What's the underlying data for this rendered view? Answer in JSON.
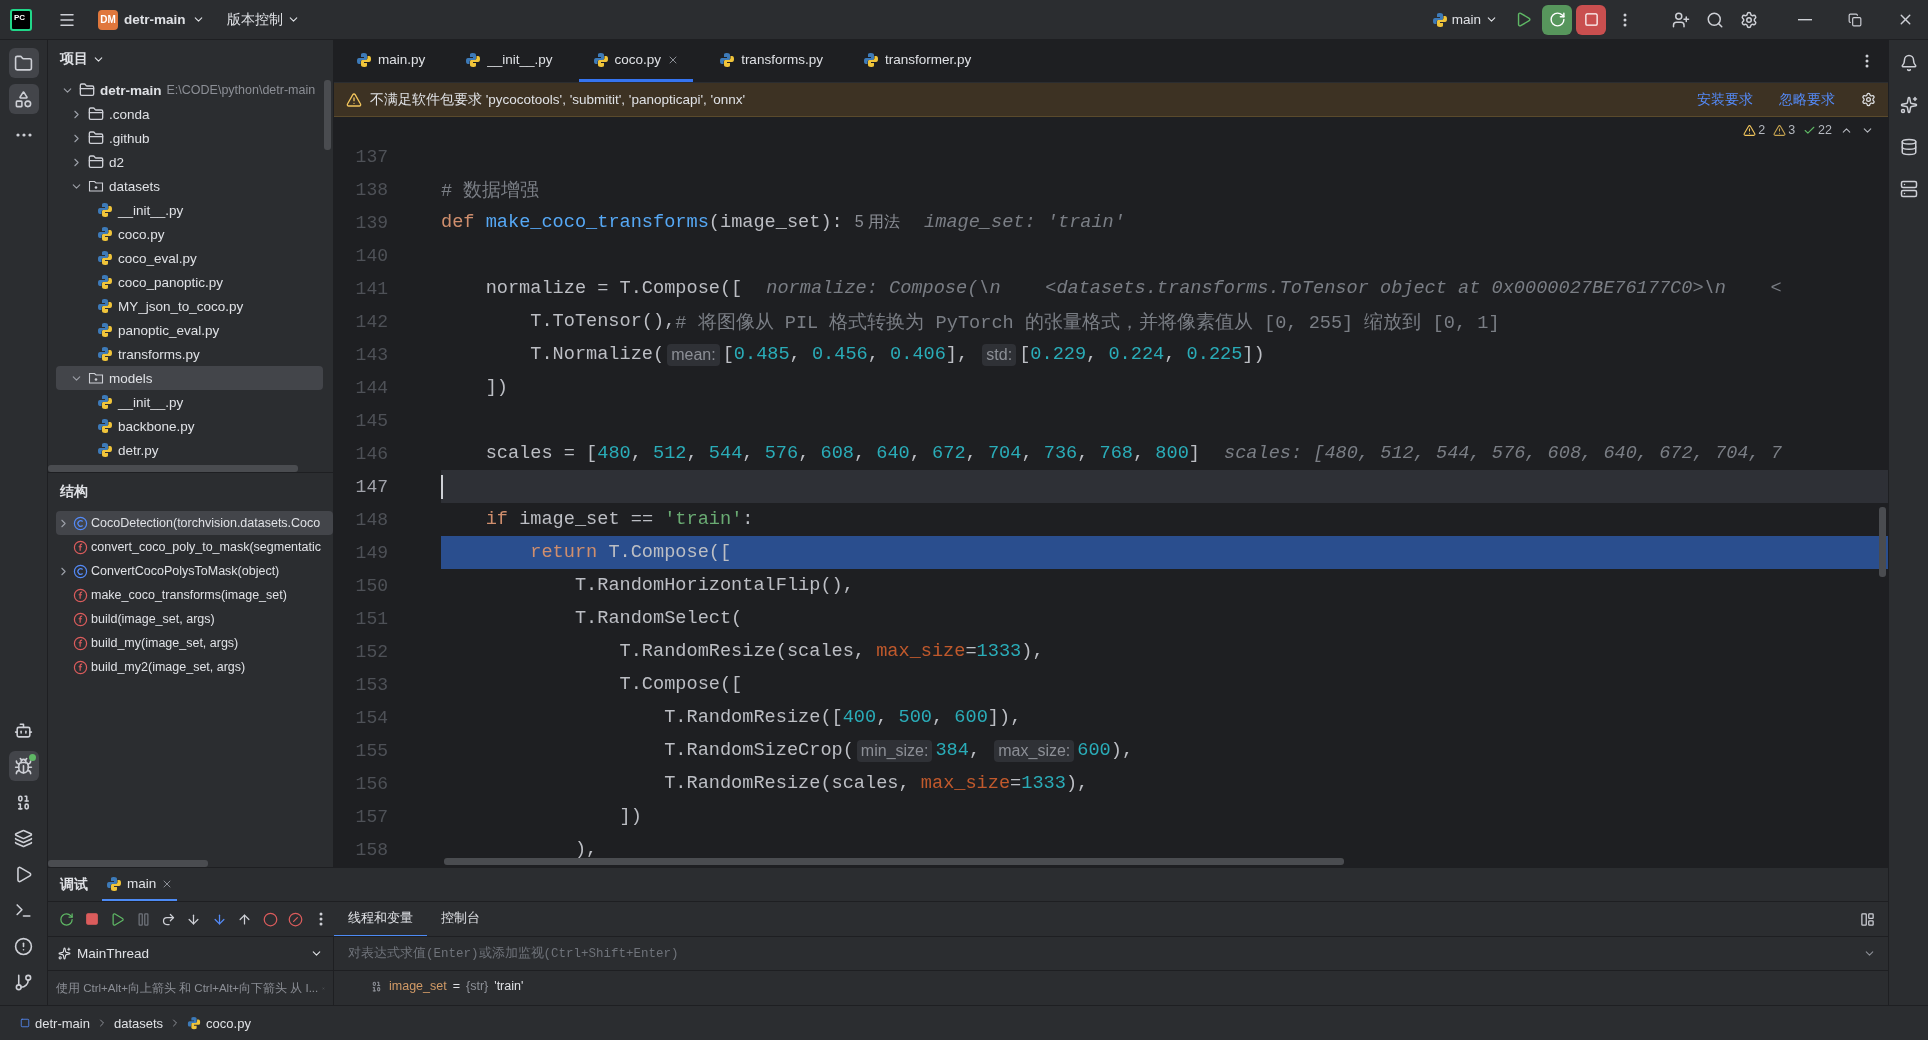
{
  "title_bar": {
    "logo": "PC",
    "project_badge": "DM",
    "project": "detr-main",
    "vcs": "版本控制",
    "run_config": "main"
  },
  "left_toolbar": {
    "top": [
      {
        "kind": "project",
        "selected": true
      },
      {
        "kind": "structure",
        "selected": true
      },
      {
        "kind": "more",
        "selected": false
      }
    ],
    "bottom": [
      {
        "kind": "bot",
        "selected": false
      },
      {
        "kind": "debug",
        "selected": true
      },
      {
        "kind": "python",
        "selected": false
      },
      {
        "kind": "layers",
        "selected": false
      },
      {
        "kind": "run",
        "selected": false
      },
      {
        "kind": "terminal",
        "selected": false
      },
      {
        "kind": "problems",
        "selected": false
      },
      {
        "kind": "git",
        "selected": false
      }
    ]
  },
  "project_panel": {
    "title": "项目",
    "tree": [
      {
        "kind": "folder",
        "label": "detr-main",
        "path": "E:\\CODE\\python\\detr-main",
        "expanded": true,
        "selected": false,
        "children": [
          {
            "kind": "folder",
            "label": ".conda",
            "expanded": false,
            "selected": false
          },
          {
            "kind": "folder",
            "label": ".github",
            "expanded": false,
            "selected": false
          },
          {
            "kind": "folder",
            "label": "d2",
            "expanded": false,
            "selected": false
          },
          {
            "kind": "package",
            "label": "datasets",
            "expanded": true,
            "selected": false,
            "children": [
              {
                "kind": "python",
                "label": "__init__.py",
                "selected": false
              },
              {
                "kind": "python",
                "label": "coco.py",
                "selected": false
              },
              {
                "kind": "python",
                "label": "coco_eval.py",
                "selected": false
              },
              {
                "kind": "python",
                "label": "coco_panoptic.py",
                "selected": false
              },
              {
                "kind": "python",
                "label": "MY_json_to_coco.py",
                "selected": false
              },
              {
                "kind": "python",
                "label": "panoptic_eval.py",
                "selected": false
              },
              {
                "kind": "python",
                "label": "transforms.py",
                "selected": false
              }
            ]
          },
          {
            "kind": "package",
            "label": "models",
            "expanded": true,
            "selected": true,
            "children": [
              {
                "kind": "python",
                "label": "__init__.py",
                "selected": false
              },
              {
                "kind": "python",
                "label": "backbone.py",
                "selected": false
              },
              {
                "kind": "python",
                "label": "detr.py",
                "selected": false
              }
            ]
          }
        ]
      }
    ]
  },
  "structure_panel": {
    "title": "结构",
    "items": [
      {
        "kind": "class",
        "label": "CocoDetection(torchvision.datasets.Coco",
        "expanded": false,
        "selected": true
      },
      {
        "kind": "function",
        "label": "convert_coco_poly_to_mask(segmentatic",
        "selected": false
      },
      {
        "kind": "class",
        "label": "ConvertCocoPolysToMask(object)",
        "expanded": false,
        "selected": false
      },
      {
        "kind": "function",
        "label": "make_coco_transforms(image_set)",
        "selected": false
      },
      {
        "kind": "function",
        "label": "build(image_set, args)",
        "selected": false
      },
      {
        "kind": "function",
        "label": "build_my(image_set, args)",
        "selected": false
      },
      {
        "kind": "function",
        "label": "build_my2(image_set, args)",
        "selected": false
      }
    ]
  },
  "tabs": [
    {
      "label": "main.py",
      "selected": false
    },
    {
      "label": "__init__.py",
      "selected": false
    },
    {
      "label": "coco.py",
      "selected": true
    },
    {
      "label": "transforms.py",
      "selected": false
    },
    {
      "label": "transformer.py",
      "selected": false
    }
  ],
  "notification": {
    "text": "不满足软件包要求 'pycocotools', 'submitit', 'panopticapi', 'onnx'",
    "actions": [
      "安装要求",
      "忽略要求"
    ]
  },
  "inspections": {
    "errors": "2",
    "warnings": "3",
    "ok": "22"
  },
  "editor": {
    "lines": [
      {
        "number": "137",
        "highlighted": false,
        "caret": false
      },
      {
        "number": "138",
        "highlighted": false,
        "caret": false,
        "tokens": [
          {
            "kind": "comment",
            "text": "# 数据增强"
          }
        ]
      },
      {
        "number": "139",
        "highlighted": false,
        "caret": false,
        "tokens": [
          {
            "kind": "keyword",
            "text": "def"
          },
          {
            "kind": "function",
            "text": " make_coco_transforms"
          },
          {
            "kind": "text",
            "text": "(image_set):"
          },
          {
            "kind": "usages",
            "text": "5 用法"
          },
          {
            "kind": "inline",
            "text": "image_set: 'train'"
          }
        ]
      },
      {
        "number": "140",
        "highlighted": false,
        "caret": false
      },
      {
        "number": "141",
        "highlighted": false,
        "caret": false,
        "tokens": [
          {
            "kind": "text",
            "text": "    normalize = T.Compose(["
          },
          {
            "kind": "inline",
            "text": "normalize: Compose(\\n    <datasets.transforms.ToTensor object at 0x0000027BE76177C0>\\n    <"
          }
        ]
      },
      {
        "number": "142",
        "highlighted": false,
        "caret": false,
        "tokens": [
          {
            "kind": "text",
            "text": "        T.ToTensor(),"
          },
          {
            "kind": "comment",
            "text": "# 将图像从 PIL 格式转换为 PyTorch 的张量格式，并将像素值从 [0, 255] 缩放到 [0, 1]"
          }
        ]
      },
      {
        "number": "143",
        "highlighted": false,
        "caret": false,
        "tokens": [
          {
            "kind": "text",
            "text": "        T.Normalize("
          },
          {
            "kind": "hint",
            "text": "mean:"
          },
          {
            "kind": "text",
            "text": "["
          },
          {
            "kind": "number",
            "text": "0.485"
          },
          {
            "kind": "text",
            "text": ", "
          },
          {
            "kind": "number",
            "text": "0.456"
          },
          {
            "kind": "text",
            "text": ", "
          },
          {
            "kind": "number",
            "text": "0.406"
          },
          {
            "kind": "text",
            "text": "], "
          },
          {
            "kind": "hint",
            "text": "std:"
          },
          {
            "kind": "text",
            "text": "["
          },
          {
            "kind": "number",
            "text": "0.229"
          },
          {
            "kind": "text",
            "text": ", "
          },
          {
            "kind": "number",
            "text": "0.224"
          },
          {
            "kind": "text",
            "text": ", "
          },
          {
            "kind": "number",
            "text": "0.225"
          },
          {
            "kind": "text",
            "text": "])"
          }
        ]
      },
      {
        "number": "144",
        "highlighted": false,
        "caret": false,
        "tokens": [
          {
            "kind": "text",
            "text": "    ])"
          }
        ]
      },
      {
        "number": "145",
        "highlighted": false,
        "caret": false
      },
      {
        "number": "146",
        "highlighted": false,
        "caret": false,
        "tokens": [
          {
            "kind": "text",
            "text": "    scales = ["
          },
          {
            "kind": "number",
            "text": "480"
          },
          {
            "kind": "text",
            "text": ", "
          },
          {
            "kind": "number",
            "text": "512"
          },
          {
            "kind": "text",
            "text": ", "
          },
          {
            "kind": "number",
            "text": "544"
          },
          {
            "kind": "text",
            "text": ", "
          },
          {
            "kind": "number",
            "text": "576"
          },
          {
            "kind": "text",
            "text": ", "
          },
          {
            "kind": "number",
            "text": "608"
          },
          {
            "kind": "text",
            "text": ", "
          },
          {
            "kind": "number",
            "text": "640"
          },
          {
            "kind": "text",
            "text": ", "
          },
          {
            "kind": "number",
            "text": "672"
          },
          {
            "kind": "text",
            "text": ", "
          },
          {
            "kind": "number",
            "text": "704"
          },
          {
            "kind": "text",
            "text": ", "
          },
          {
            "kind": "number",
            "text": "736"
          },
          {
            "kind": "text",
            "text": ", "
          },
          {
            "kind": "number",
            "text": "768"
          },
          {
            "kind": "text",
            "text": ", "
          },
          {
            "kind": "number",
            "text": "800"
          },
          {
            "kind": "text",
            "text": "]"
          },
          {
            "kind": "inline",
            "text": "scales: [480, 512, 544, 576, 608, 640, 672, 704, 7"
          }
        ]
      },
      {
        "number": "147",
        "highlighted": false,
        "caret": true
      },
      {
        "number": "148",
        "highlighted": false,
        "caret": false,
        "tokens": [
          {
            "kind": "keyword",
            "text": "    if"
          },
          {
            "kind": "text",
            "text": " image_set == "
          },
          {
            "kind": "string",
            "text": "'train'"
          },
          {
            "kind": "text",
            "text": ":"
          }
        ]
      },
      {
        "number": "149",
        "highlighted": true,
        "caret": false,
        "tokens": [
          {
            "kind": "keyword",
            "text": "        return"
          },
          {
            "kind": "text",
            "text": " T.Compose(["
          }
        ]
      },
      {
        "number": "150",
        "highlighted": false,
        "caret": false,
        "tokens": [
          {
            "kind": "text",
            "text": "            T.RandomHorizontalFlip(),"
          }
        ]
      },
      {
        "number": "151",
        "highlighted": false,
        "caret": false,
        "tokens": [
          {
            "kind": "text",
            "text": "            T.RandomSelect("
          }
        ]
      },
      {
        "number": "152",
        "highlighted": false,
        "caret": false,
        "tokens": [
          {
            "kind": "text",
            "text": "                T.RandomResize(scales, "
          },
          {
            "kind": "kwarg",
            "text": "max_size"
          },
          {
            "kind": "text",
            "text": "="
          },
          {
            "kind": "number",
            "text": "1333"
          },
          {
            "kind": "text",
            "text": "),"
          }
        ]
      },
      {
        "number": "153",
        "highlighted": false,
        "caret": false,
        "tokens": [
          {
            "kind": "text",
            "text": "                T.Compose(["
          }
        ]
      },
      {
        "number": "154",
        "highlighted": false,
        "caret": false,
        "tokens": [
          {
            "kind": "text",
            "text": "                    T.RandomResize(["
          },
          {
            "kind": "number",
            "text": "400"
          },
          {
            "kind": "text",
            "text": ", "
          },
          {
            "kind": "number",
            "text": "500"
          },
          {
            "kind": "text",
            "text": ", "
          },
          {
            "kind": "number",
            "text": "600"
          },
          {
            "kind": "text",
            "text": "]),"
          }
        ]
      },
      {
        "number": "155",
        "highlighted": false,
        "caret": false,
        "tokens": [
          {
            "kind": "text",
            "text": "                    T.RandomSizeCrop("
          },
          {
            "kind": "hint",
            "text": "min_size:"
          },
          {
            "kind": "number",
            "text": "384"
          },
          {
            "kind": "text",
            "text": ", "
          },
          {
            "kind": "hint",
            "text": "max_size:"
          },
          {
            "kind": "number",
            "text": "600"
          },
          {
            "kind": "text",
            "text": "),"
          }
        ]
      },
      {
        "number": "156",
        "highlighted": false,
        "caret": false,
        "tokens": [
          {
            "kind": "text",
            "text": "                    T.RandomResize(scales, "
          },
          {
            "kind": "kwarg",
            "text": "max_size"
          },
          {
            "kind": "text",
            "text": "="
          },
          {
            "kind": "number",
            "text": "1333"
          },
          {
            "kind": "text",
            "text": "),"
          }
        ]
      },
      {
        "number": "157",
        "highlighted": false,
        "caret": false,
        "tokens": [
          {
            "kind": "text",
            "text": "                ])"
          }
        ]
      },
      {
        "number": "158",
        "highlighted": false,
        "caret": false,
        "tokens": [
          {
            "kind": "text",
            "text": "            ),"
          }
        ]
      }
    ]
  },
  "debug_panel": {
    "title": "调试",
    "session_tab": "main",
    "tabs": [
      {
        "label": "线程和变量",
        "selected": true
      },
      {
        "label": "控制台",
        "selected": false
      }
    ],
    "thread": "MainThread",
    "hint": "使用 Ctrl+Alt+向上箭头 和 Ctrl+Alt+向下箭头 从 I...",
    "watch_placeholder": "对表达式求值(Enter)或添加监视(Ctrl+Shift+Enter)",
    "variables": [
      {
        "name": "image_set",
        "operator": "=",
        "type": "{str}",
        "value": "'train'"
      }
    ]
  },
  "status_bar": {
    "breadcrumbs": [
      {
        "kind": "module",
        "label": "detr-main"
      },
      {
        "kind": "folder",
        "label": "datasets"
      },
      {
        "kind": "python",
        "label": "coco.py"
      }
    ]
  }
}
